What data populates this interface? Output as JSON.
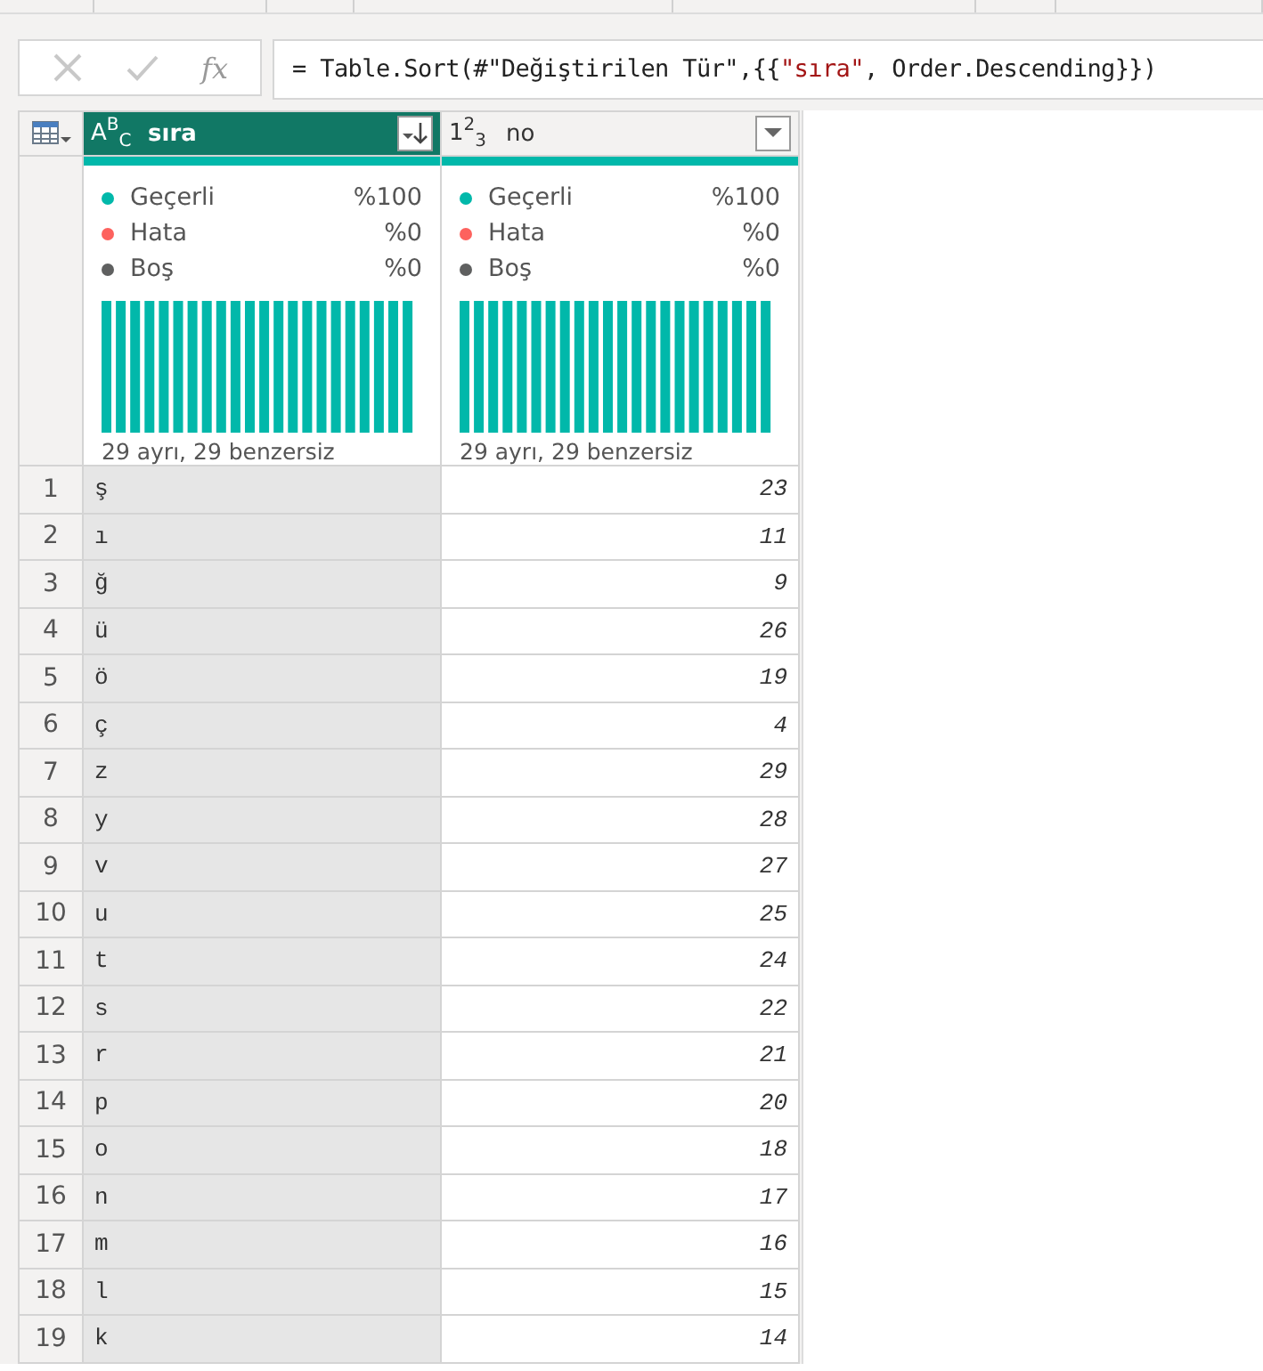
{
  "formula_bar": {
    "fx_label": "fx",
    "segments": [
      {
        "kind": "code",
        "text": "= Table.Sort(#\"Değiştirilen Tür\",{{"
      },
      {
        "kind": "string",
        "text": "\"sıra\""
      },
      {
        "kind": "code",
        "text": ", Order.Descending}})"
      }
    ]
  },
  "columns": [
    {
      "name": "sıra",
      "type_icon": "A$^{B}$$_{C}$",
      "kind": "text",
      "selected": true,
      "sorted": true,
      "quality": [
        {
          "label": "Geçerli",
          "value": "%100",
          "color": "#01b8aa"
        },
        {
          "label": "Hata",
          "value": "%0",
          "color": "#fd625e"
        },
        {
          "label": "Boş",
          "value": "%0",
          "color": "#5f6060"
        }
      ],
      "distribution": "29 ayrı, 29 benzersiz"
    },
    {
      "name": "no",
      "type_icon": "1$^{2}$$_{3}$",
      "kind": "number",
      "selected": false,
      "sorted": false,
      "quality": [
        {
          "label": "Geçerli",
          "value": "%100",
          "color": "#01b8aa"
        },
        {
          "label": "Hata",
          "value": "%0",
          "color": "#fd625e"
        },
        {
          "label": "Boş",
          "value": "%0",
          "color": "#5f6060"
        }
      ],
      "distribution": "29 ayrı, 29 benzersiz"
    }
  ],
  "rows": [
    {
      "index": "1",
      "cells": [
        "ş",
        "23"
      ]
    },
    {
      "index": "2",
      "cells": [
        "ı",
        "11"
      ]
    },
    {
      "index": "3",
      "cells": [
        "ğ",
        "9"
      ]
    },
    {
      "index": "4",
      "cells": [
        "ü",
        "26"
      ]
    },
    {
      "index": "5",
      "cells": [
        "ö",
        "19"
      ]
    },
    {
      "index": "6",
      "cells": [
        "ç",
        "4"
      ]
    },
    {
      "index": "7",
      "cells": [
        "z",
        "29"
      ]
    },
    {
      "index": "8",
      "cells": [
        "y",
        "28"
      ]
    },
    {
      "index": "9",
      "cells": [
        "v",
        "27"
      ]
    },
    {
      "index": "10",
      "cells": [
        "u",
        "25"
      ]
    },
    {
      "index": "11",
      "cells": [
        "t",
        "24"
      ]
    },
    {
      "index": "12",
      "cells": [
        "s",
        "22"
      ]
    },
    {
      "index": "13",
      "cells": [
        "r",
        "21"
      ]
    },
    {
      "index": "14",
      "cells": [
        "p",
        "20"
      ]
    },
    {
      "index": "15",
      "cells": [
        "o",
        "18"
      ]
    },
    {
      "index": "16",
      "cells": [
        "n",
        "17"
      ]
    },
    {
      "index": "17",
      "cells": [
        "m",
        "16"
      ]
    },
    {
      "index": "18",
      "cells": [
        "l",
        "15"
      ]
    },
    {
      "index": "19",
      "cells": [
        "k",
        "14"
      ]
    }
  ]
}
